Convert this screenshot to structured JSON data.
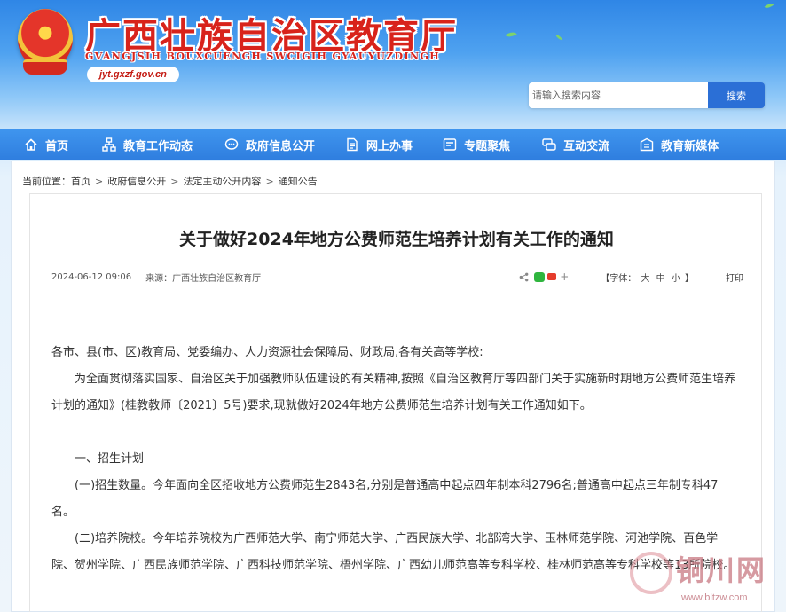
{
  "header": {
    "title": "广西壮族自治区教育厅",
    "subtitle": "GVANGJSIH BOUXCUENGH SWCIGIH GYAUYUZDINGH",
    "domain": "jyt.gxzf.gov.cn",
    "search_placeholder": "请输入搜索内容",
    "search_button": "搜索"
  },
  "nav": {
    "items": [
      {
        "label": "首页",
        "icon": "home-icon"
      },
      {
        "label": "教育工作动态",
        "icon": "org-chart-icon"
      },
      {
        "label": "政府信息公开",
        "icon": "chat-bubble-icon"
      },
      {
        "label": "网上办事",
        "icon": "document-edit-icon"
      },
      {
        "label": "专题聚焦",
        "icon": "topic-icon"
      },
      {
        "label": "互动交流",
        "icon": "interaction-icon"
      },
      {
        "label": "教育新媒体",
        "icon": "media-icon"
      }
    ]
  },
  "breadcrumb": {
    "prefix": "当前位置：",
    "items": [
      "首页",
      "政府信息公开",
      "法定主动公开内容",
      "通知公告"
    ],
    "separator": ">"
  },
  "article": {
    "title": "关于做好2024年地方公费师范生培养计划有关工作的通知",
    "date": "2024-06-12 09:06",
    "source": "来源：广西壮族自治区教育厅",
    "font_label": "【字体：",
    "font_sizes": [
      "大",
      "中",
      "小"
    ],
    "font_close": "】",
    "print_label": "打印",
    "paragraphs": [
      "各市、县(市、区)教育局、党委编办、人力资源社会保障局、财政局,各有关高等学校:",
      "为全面贯彻落实国家、自治区关于加强教师队伍建设的有关精神,按照《自治区教育厅等四部门关于实施新时期地方公费师范生培养计划的通知》(桂教教师〔2021〕5号)要求,现就做好2024年地方公费师范生培养计划有关工作通知如下。",
      "一、招生计划",
      "(一)招生数量。今年面向全区招收地方公费师范生2843名,分别是普通高中起点四年制本科2796名;普通高中起点三年制专科47名。",
      "(二)培养院校。今年培养院校为广西师范大学、南宁师范大学、广西民族大学、北部湾大学、玉林师范学院、河池学院、百色学院、贺州学院、广西民族师范学院、广西科技师范学院、梧州学院、广西幼儿师范高等专科学校、桂林师范高等专科学校等13所院校。"
    ]
  },
  "watermark": {
    "text": "铜川网",
    "url": "www.bltzw.com"
  },
  "colors": {
    "brand_red": "#d8231b",
    "nav_blue": "#2f7edf",
    "search_blue": "#2b6fd6"
  }
}
